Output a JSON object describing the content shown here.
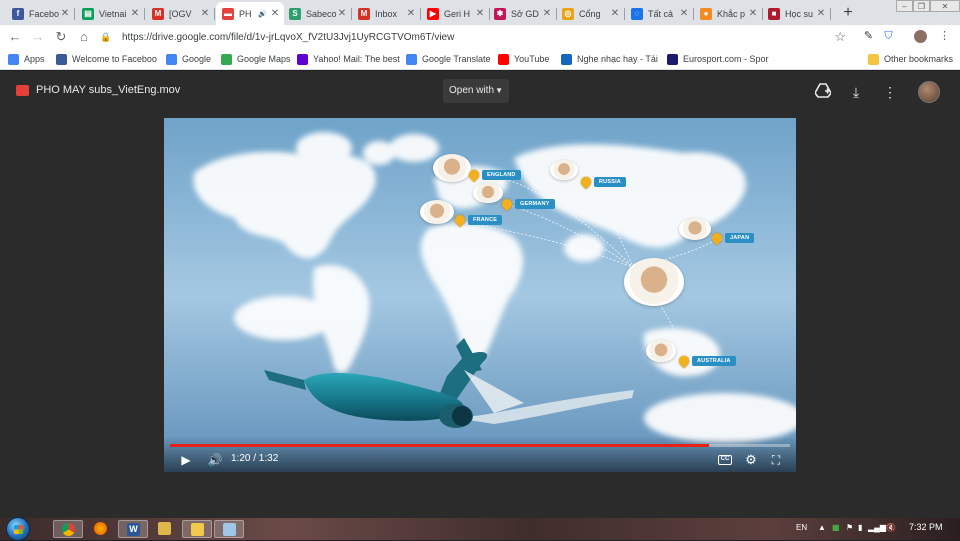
{
  "tabs": [
    {
      "label": "Facebo",
      "icon": "facebook-icon",
      "color": "#3b5998",
      "glyph": "f"
    },
    {
      "label": "Vietnai",
      "icon": "sheets-icon",
      "color": "#0f9d58",
      "glyph": "▤"
    },
    {
      "label": "[OGV",
      "icon": "gmail-icon",
      "color": "#d93025",
      "glyph": "M"
    },
    {
      "label": "PH",
      "icon": "drive-video-icon",
      "color": "#e5413a",
      "glyph": "▬",
      "active": true
    },
    {
      "label": "Sabeco",
      "icon": "sabeco-icon",
      "color": "#2e9e6e",
      "glyph": "S"
    },
    {
      "label": "Inbox",
      "icon": "gmail-icon",
      "color": "#d93025",
      "glyph": "M"
    },
    {
      "label": "Geri H",
      "icon": "youtube-icon",
      "color": "#ff0000",
      "glyph": "▶"
    },
    {
      "label": "Sở GD",
      "icon": "snowflake-icon",
      "color": "#c2185b",
      "glyph": "✱"
    },
    {
      "label": "Cổng",
      "icon": "portal-icon",
      "color": "#e8a317",
      "glyph": "◎"
    },
    {
      "label": "Tất cả",
      "icon": "loading-icon",
      "color": "#1a73e8",
      "glyph": "◌"
    },
    {
      "label": "Khắc p",
      "icon": "food-icon",
      "color": "#f28b20",
      "glyph": "●"
    },
    {
      "label": "Học su",
      "icon": "book-icon",
      "color": "#b0182d",
      "glyph": "■"
    }
  ],
  "toolbar": {
    "url": "https://drive.google.com/file/d/1v-jrLqvoX_fV2tU3Jvj1UyRCGTVOm6T/view"
  },
  "bookmarks": [
    {
      "label": "Apps",
      "icon": "apps-grid-icon",
      "color": "#4285f4"
    },
    {
      "label": "Welcome to Faceboo",
      "icon": "facebook-icon",
      "color": "#3b5998"
    },
    {
      "label": "Google",
      "icon": "google-icon",
      "color": "#4285f4"
    },
    {
      "label": "Google Maps",
      "icon": "maps-icon",
      "color": "#34a853"
    },
    {
      "label": "Yahoo! Mail: The best",
      "icon": "yahoo-icon",
      "color": "#6001d2"
    },
    {
      "label": "Google Translate",
      "icon": "translate-icon",
      "color": "#4285f4"
    },
    {
      "label": "YouTube",
      "icon": "youtube-icon",
      "color": "#ff0000"
    },
    {
      "label": "Nghe nhạc hay - Tải",
      "icon": "music-icon",
      "color": "#1565c0"
    },
    {
      "label": "Eurosport.com - Spor",
      "icon": "eurosport-icon",
      "color": "#1a1a6e"
    },
    {
      "label": "Other bookmarks",
      "icon": "folder-icon",
      "color": "#f5c542"
    }
  ],
  "viewer": {
    "file_name": "PHO MAY subs_VietEng.mov",
    "open_with": "Open with"
  },
  "video": {
    "destinations": [
      "ENGLAND",
      "RUSSIA",
      "GERMANY",
      "FRANCE",
      "JAPAN",
      "AUSTRALIA"
    ],
    "time_display": "1:20 / 1:32",
    "progress": 0.87,
    "cc_label": "CC"
  },
  "taskbar": {
    "language": "EN",
    "clock": "7:32 PM"
  }
}
